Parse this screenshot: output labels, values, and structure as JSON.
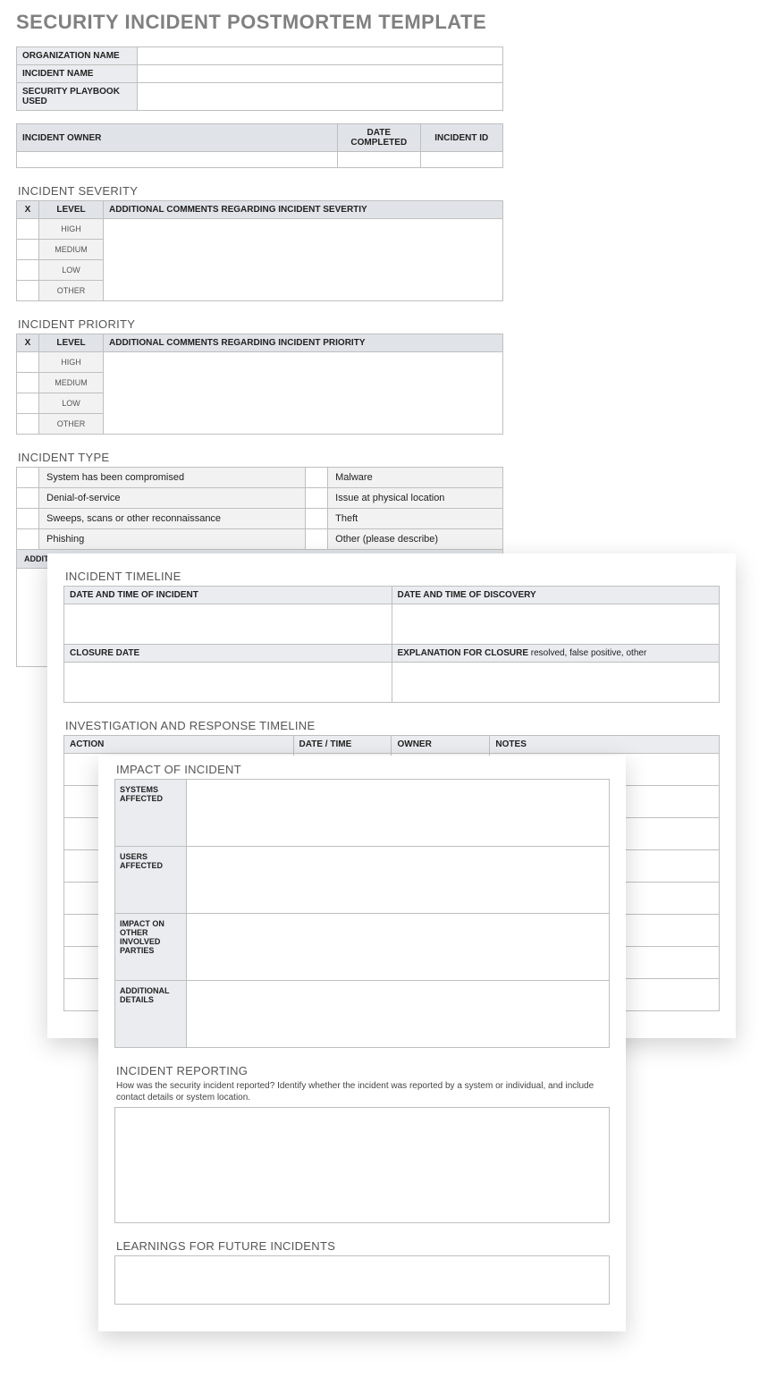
{
  "title": "SECURITY INCIDENT POSTMORTEM TEMPLATE",
  "infoTable": {
    "rows": [
      "ORGANIZATION NAME",
      "INCIDENT NAME",
      "SECURITY PLAYBOOK USED"
    ]
  },
  "ownerTable": {
    "headers": [
      "INCIDENT OWNER",
      "DATE COMPLETED",
      "INCIDENT ID"
    ]
  },
  "severity": {
    "heading": "INCIDENT SEVERITY",
    "cols": [
      "X",
      "LEVEL",
      "ADDITIONAL COMMENTS REGARDING INCIDENT SEVERTIY"
    ],
    "levels": [
      "HIGH",
      "MEDIUM",
      "LOW",
      "OTHER"
    ]
  },
  "priority": {
    "heading": "INCIDENT PRIORITY",
    "cols": [
      "X",
      "LEVEL",
      "ADDITIONAL COMMENTS REGARDING INCIDENT PRIORITY"
    ],
    "levels": [
      "HIGH",
      "MEDIUM",
      "LOW",
      "OTHER"
    ]
  },
  "type": {
    "heading": "INCIDENT TYPE",
    "left": [
      "System has been compromised",
      "Denial-of-service",
      "Sweeps, scans or other reconnaissance",
      "Phishing"
    ],
    "right": [
      "Malware",
      "Issue at physical location",
      "Theft",
      "Other (please describe)"
    ],
    "additional": "ADDITIONAL COMMENTS / \"OTHER\" DESCRIPTION"
  },
  "timeline": {
    "heading": "INCIDENT TIMELINE",
    "h1": "DATE AND TIME OF INCIDENT",
    "h2": "DATE AND TIME OF DISCOVERY",
    "h3": "CLOSURE DATE",
    "h4a": "EXPLANATION FOR CLOSURE",
    "h4b": "  resolved, false positive, other"
  },
  "investigation": {
    "heading": "INVESTIGATION AND RESPONSE TIMELINE",
    "cols": [
      "ACTION",
      "DATE / TIME",
      "OWNER",
      "NOTES"
    ]
  },
  "impact": {
    "heading": "IMPACT OF INCIDENT",
    "rows": [
      "SYSTEMS AFFECTED",
      "USERS AFFECTED",
      "IMPACT ON OTHER INVOLVED PARTIES",
      "ADDITIONAL DETAILS"
    ]
  },
  "reporting": {
    "heading": "INCIDENT REPORTING",
    "sub": "How was the security incident reported? Identify whether the incident was reported by a system or individual, and include contact details or system location."
  },
  "learnings": {
    "heading": "LEARNINGS FOR FUTURE INCIDENTS"
  }
}
